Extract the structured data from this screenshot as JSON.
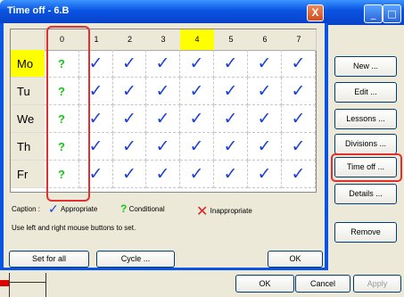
{
  "dialog": {
    "title": "Time off - 6.B",
    "close_glyph": "X",
    "columns": [
      "0",
      "1",
      "2",
      "3",
      "4",
      "5",
      "6",
      "7"
    ],
    "highlighted_column": "4",
    "rows": [
      {
        "label": "Mo",
        "cells": [
          "?",
          "✓",
          "✓",
          "✓",
          "✓",
          "✓",
          "✓",
          "✓"
        ]
      },
      {
        "label": "Tu",
        "cells": [
          "?",
          "✓",
          "✓",
          "✓",
          "✓",
          "✓",
          "✓",
          "✓"
        ]
      },
      {
        "label": "We",
        "cells": [
          "?",
          "✓",
          "✓",
          "✓",
          "✓",
          "✓",
          "✓",
          "✓"
        ]
      },
      {
        "label": "Th",
        "cells": [
          "?",
          "✓",
          "✓",
          "✓",
          "✓",
          "✓",
          "✓",
          "✓"
        ]
      },
      {
        "label": "Fr",
        "cells": [
          "?",
          "✓",
          "✓",
          "✓",
          "✓",
          "✓",
          "✓",
          "✓"
        ]
      }
    ],
    "caption_label": "Caption :",
    "caption_appropriate": "Appropriate",
    "caption_conditional": "Conditional",
    "caption_inappropriate": "Inappropriate",
    "hint": "Use left and right mouse buttons to set.",
    "btn_set_for_all": "Set for all",
    "btn_cycle": "Cycle ...",
    "btn_ok": "OK"
  },
  "side_panel": {
    "buttons": [
      "New ...",
      "Edit ...",
      "Lessons ...",
      "Divisions ...",
      "Time off ...",
      "Details ...",
      "Remove"
    ],
    "highlighted": "Time off ..."
  },
  "bottom": {
    "btn_ok": "OK",
    "btn_cancel": "Cancel",
    "btn_apply": "Apply"
  },
  "colors": {
    "highlight_yellow": "#ffff00",
    "check_blue": "#1a3fd8",
    "conditional_green": "#17c417",
    "annotation_red": "#e03030"
  }
}
